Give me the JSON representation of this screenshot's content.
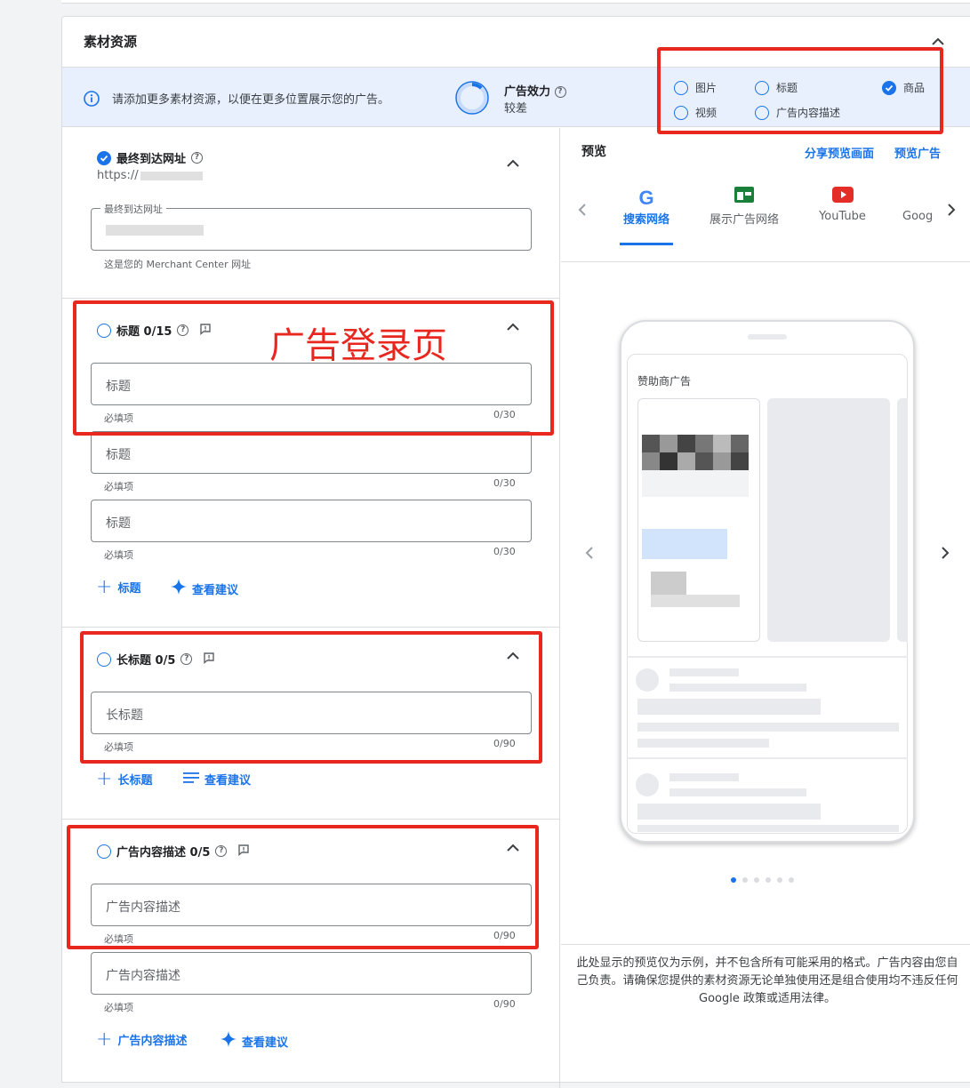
{
  "section_title": "素材资源",
  "banner": {
    "message": "请添加更多素材资源，以便在更多位置展示您的广告。",
    "effect_label": "广告效力",
    "effect_value": "较差",
    "effect_progress": 0.12
  },
  "asset_checks": [
    {
      "label": "图片",
      "checked": false
    },
    {
      "label": "标题",
      "checked": false
    },
    {
      "label": "商品",
      "checked": true
    },
    {
      "label": "视频",
      "checked": false
    },
    {
      "label": "广告内容描述",
      "checked": false
    }
  ],
  "final_url": {
    "title": "最终到达网址",
    "url_prefix": "https://",
    "field_label": "最终到达网址",
    "hint": "这是您的 Merchant Center 网址",
    "annotation": "广告登录页"
  },
  "headlines": {
    "title": "标题 0/15",
    "fields": [
      {
        "placeholder": "标题",
        "hint": "必填项",
        "count": "0/30"
      },
      {
        "placeholder": "标题",
        "hint": "必填项",
        "count": "0/30"
      },
      {
        "placeholder": "标题",
        "hint": "必填项",
        "count": "0/30"
      }
    ],
    "add_label": "标题",
    "suggest_label": "查看建议"
  },
  "long_headlines": {
    "title": "长标题 0/5",
    "fields": [
      {
        "placeholder": "长标题",
        "hint": "必填项",
        "count": "0/90"
      }
    ],
    "add_label": "长标题",
    "suggest_label": "查看建议"
  },
  "descriptions": {
    "title": "广告内容描述 0/5",
    "fields": [
      {
        "placeholder": "广告内容描述",
        "hint": "必填项",
        "count": "0/90"
      },
      {
        "placeholder": "广告内容描述",
        "hint": "必填项",
        "count": "0/90"
      }
    ],
    "add_label": "广告内容描述",
    "suggest_label": "查看建议"
  },
  "preview": {
    "title": "预览",
    "share_label": "分享预览画面",
    "preview_ad_label": "预览广告",
    "tabs": [
      "搜索网络",
      "展示广告网络",
      "YouTube",
      "Goog"
    ],
    "active_tab": 0,
    "sponsored_label": "赞助商广告",
    "disclaimer": "此处显示的预览仅为示例，并不包含所有可能采用的格式。广告内容由您自己负责。请确保您提供的素材资源无论单独使用还是组合使用均不违反任何 Google 政策或适用法律。",
    "page_dots": 6,
    "active_dot": 0
  },
  "colors": {
    "accent": "#1a73e8",
    "annotation_red": "#e8271f",
    "banner_bg": "#e8f0fe"
  }
}
